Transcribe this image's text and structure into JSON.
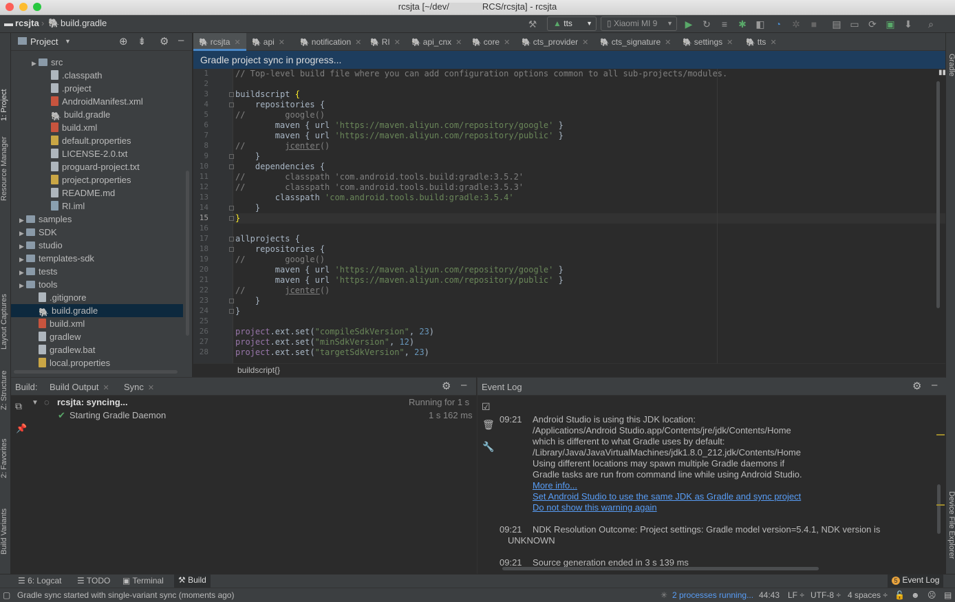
{
  "window": {
    "title_prefix": "rcsjta [~/dev/",
    "title_suffix": "RCS/rcsjta] - rcsjta"
  },
  "nav": {
    "project": "rcsjta",
    "file": "build.gradle",
    "run_config": "tts",
    "device": "Xiaomi MI 9"
  },
  "project_panel": {
    "title": "Project",
    "items": [
      {
        "label": "src",
        "icon": "folder-icon",
        "indent": 2,
        "arrow": "▶"
      },
      {
        "label": ".classpath",
        "icon": "file-icon",
        "indent": 3,
        "arrow": ""
      },
      {
        "label": ".project",
        "icon": "file-icon",
        "indent": 3,
        "arrow": ""
      },
      {
        "label": "AndroidManifest.xml",
        "icon": "xml-icon",
        "indent": 3,
        "arrow": ""
      },
      {
        "label": "build.gradle",
        "icon": "gradle-icon",
        "indent": 3,
        "arrow": ""
      },
      {
        "label": "build.xml",
        "icon": "xml-icon",
        "indent": 3,
        "arrow": ""
      },
      {
        "label": "default.properties",
        "icon": "properties-icon",
        "indent": 3,
        "arrow": ""
      },
      {
        "label": "LICENSE-2.0.txt",
        "icon": "file-icon",
        "indent": 3,
        "arrow": ""
      },
      {
        "label": "proguard-project.txt",
        "icon": "file-icon",
        "indent": 3,
        "arrow": ""
      },
      {
        "label": "project.properties",
        "icon": "properties-icon",
        "indent": 3,
        "arrow": ""
      },
      {
        "label": "README.md",
        "icon": "file-icon",
        "indent": 3,
        "arrow": ""
      },
      {
        "label": "RI.iml",
        "icon": "iml-icon",
        "indent": 3,
        "arrow": ""
      },
      {
        "label": "samples",
        "icon": "folder-icon",
        "indent": 1,
        "arrow": "▶"
      },
      {
        "label": "SDK",
        "icon": "folder-icon",
        "indent": 1,
        "arrow": "▶"
      },
      {
        "label": "studio",
        "icon": "folder-icon",
        "indent": 1,
        "arrow": "▶"
      },
      {
        "label": "templates-sdk",
        "icon": "folder-icon",
        "indent": 1,
        "arrow": "▶"
      },
      {
        "label": "tests",
        "icon": "folder-icon",
        "indent": 1,
        "arrow": "▶"
      },
      {
        "label": "tools",
        "icon": "folder-icon",
        "indent": 1,
        "arrow": "▶"
      },
      {
        "label": ".gitignore",
        "icon": "file-icon",
        "indent": 2,
        "arrow": ""
      },
      {
        "label": "build.gradle",
        "icon": "gradle-icon",
        "indent": 2,
        "arrow": "",
        "selected": true
      },
      {
        "label": "build.xml",
        "icon": "xml-icon",
        "indent": 2,
        "arrow": ""
      },
      {
        "label": "gradlew",
        "icon": "file-icon",
        "indent": 2,
        "arrow": ""
      },
      {
        "label": "gradlew.bat",
        "icon": "file-icon",
        "indent": 2,
        "arrow": ""
      },
      {
        "label": "local.properties",
        "icon": "properties-icon",
        "indent": 2,
        "arrow": ""
      }
    ]
  },
  "tabs": [
    {
      "label": "rcsjta",
      "active": true
    },
    {
      "label": "api"
    },
    {
      "label": "notification"
    },
    {
      "label": "RI"
    },
    {
      "label": "api_cnx"
    },
    {
      "label": "core"
    },
    {
      "label": "cts_provider"
    },
    {
      "label": "cts_signature"
    },
    {
      "label": "settings"
    },
    {
      "label": "tts"
    }
  ],
  "sync_banner": "Gradle project sync in progress...",
  "editor": {
    "current_line": 15,
    "lines": [
      [
        {
          "t": "// Top-level build file where you can add configuration options common to all sub-projects/modules.",
          "c": "cmt"
        }
      ],
      [],
      [
        {
          "t": "buildscript "
        },
        {
          "t": "{",
          "c": "brk"
        }
      ],
      [
        {
          "t": "    repositories {"
        }
      ],
      [
        {
          "t": "//        google()",
          "c": "cmt"
        }
      ],
      [
        {
          "t": "        maven { url "
        },
        {
          "t": "'https://maven.aliyun.com/repository/google'",
          "c": "str"
        },
        {
          "t": " }"
        }
      ],
      [
        {
          "t": "        maven { url "
        },
        {
          "t": "'https://maven.aliyun.com/repository/public'",
          "c": "str"
        },
        {
          "t": " }"
        }
      ],
      [
        {
          "t": "//        ",
          "c": "cmt"
        },
        {
          "t": "jcenter",
          "c": "uline"
        },
        {
          "t": "()",
          "c": "cmt"
        }
      ],
      [
        {
          "t": "    }"
        }
      ],
      [
        {
          "t": "    dependencies {"
        }
      ],
      [
        {
          "t": "//        classpath 'com.android.tools.build:gradle:3.5.2'",
          "c": "cmt"
        }
      ],
      [
        {
          "t": "//        classpath 'com.android.tools.build:gradle:3.5.3'",
          "c": "cmt"
        }
      ],
      [
        {
          "t": "        classpath "
        },
        {
          "t": "'com.android.tools.build:gradle:3.5.4'",
          "c": "str"
        }
      ],
      [
        {
          "t": "    }"
        }
      ],
      [
        {
          "t": "}",
          "c": "brk"
        }
      ],
      [],
      [
        {
          "t": "allprojects {"
        }
      ],
      [
        {
          "t": "    repositories {"
        }
      ],
      [
        {
          "t": "//        google()",
          "c": "cmt"
        }
      ],
      [
        {
          "t": "        maven { url "
        },
        {
          "t": "'https://maven.aliyun.com/repository/google'",
          "c": "str"
        },
        {
          "t": " }"
        }
      ],
      [
        {
          "t": "        maven { url "
        },
        {
          "t": "'https://maven.aliyun.com/repository/public'",
          "c": "str"
        },
        {
          "t": " }"
        }
      ],
      [
        {
          "t": "//        ",
          "c": "cmt"
        },
        {
          "t": "jcenter",
          "c": "uline"
        },
        {
          "t": "()",
          "c": "cmt"
        }
      ],
      [
        {
          "t": "    }"
        }
      ],
      [
        {
          "t": "}"
        }
      ],
      [],
      [
        {
          "t": "project",
          "c": "prj"
        },
        {
          "t": ".ext.set("
        },
        {
          "t": "\"compileSdkVersion\"",
          "c": "str"
        },
        {
          "t": ", "
        },
        {
          "t": "23",
          "c": "num"
        },
        {
          "t": ")"
        }
      ],
      [
        {
          "t": "project",
          "c": "prj"
        },
        {
          "t": ".ext.set("
        },
        {
          "t": "\"minSdkVersion\"",
          "c": "str"
        },
        {
          "t": ", "
        },
        {
          "t": "12",
          "c": "num"
        },
        {
          "t": ")"
        }
      ],
      [
        {
          "t": "project",
          "c": "prj"
        },
        {
          "t": ".ext.set("
        },
        {
          "t": "\"targetSdkVersion\"",
          "c": "str"
        },
        {
          "t": ", "
        },
        {
          "t": "23",
          "c": "num"
        },
        {
          "t": ")"
        }
      ]
    ],
    "breadcrumb": "buildscript{}"
  },
  "build_panel": {
    "label": "Build:",
    "tabs": [
      "Build Output",
      "Sync"
    ],
    "root": "rcsjta: syncing...",
    "root_time": "Running for 1 s",
    "child": "Starting Gradle Daemon",
    "child_time": "1 s 162 ms"
  },
  "event_log": {
    "title": "Event Log",
    "entries": [
      {
        "time": "09:21",
        "lines": [
          "Android Studio is using this JDK location:",
          "/Applications/Android Studio.app/Contents/jre/jdk/Contents/Home",
          "which is different to what Gradle uses by default:",
          "/Library/Java/JavaVirtualMachines/jdk1.8.0_212.jdk/Contents/Home",
          "Using different locations may spawn multiple Gradle daemons if",
          "Gradle tasks are run from command line while using Android Studio."
        ],
        "links": [
          "More info...",
          "Set Android Studio to use the same JDK as Gradle and sync project",
          "Do not show this warning again"
        ]
      },
      {
        "time": "09:21",
        "line1": "NDK Resolution Outcome: Project settings: Gradle model version=5.4.1, NDK version is",
        "line2": "UNKNOWN"
      },
      {
        "time": "09:21",
        "line1": "Source generation ended in 3 s 139 ms"
      }
    ]
  },
  "left_stripe": [
    "1: Project",
    "Resource Manager",
    "Layout Captures",
    "Z: Structure",
    "2: Favorites",
    "Build Variants"
  ],
  "right_stripe": [
    "Gradle",
    "Device File Explorer"
  ],
  "tool_windows": {
    "logcat": "6: Logcat",
    "todo": "TODO",
    "terminal": "Terminal",
    "build": "Build",
    "event_log": "Event Log",
    "event_count": "5"
  },
  "status": {
    "message": "Gradle sync started with single-variant sync (moments ago)",
    "processes": "2 processes running...",
    "position": "44:43",
    "line_sep": "LF",
    "encoding": "UTF-8",
    "indent": "4 spaces"
  },
  "colors": {
    "accent": "#4a88c7",
    "banner": "#1d3d5e",
    "link": "#589df6",
    "success": "#59a869"
  }
}
